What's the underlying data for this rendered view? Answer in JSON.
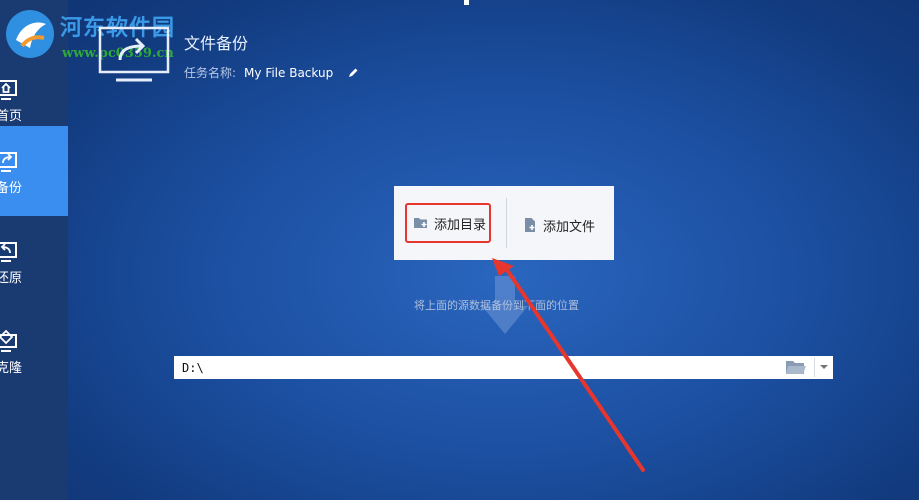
{
  "watermark": {
    "title": "河东软件园",
    "url": "www.pc0359.cn"
  },
  "sidebar": {
    "items": [
      {
        "label": "首页",
        "icon": "home-icon"
      },
      {
        "label": "备份",
        "icon": "backup-icon",
        "active": true
      },
      {
        "label": "还原",
        "icon": "restore-icon"
      },
      {
        "label": "克隆",
        "icon": "clone-icon"
      }
    ]
  },
  "header": {
    "title": "文件备份",
    "task_label": "任务名称:",
    "task_name": "My File Backup"
  },
  "source_panel": {
    "add_dir_label": "添加目录",
    "add_file_label": "添加文件"
  },
  "hint": "将上面的源数据备份到下面的位置",
  "destination": {
    "path": "D:\\"
  },
  "colors": {
    "accent": "#3a8ef0",
    "highlight": "#e6362e"
  }
}
